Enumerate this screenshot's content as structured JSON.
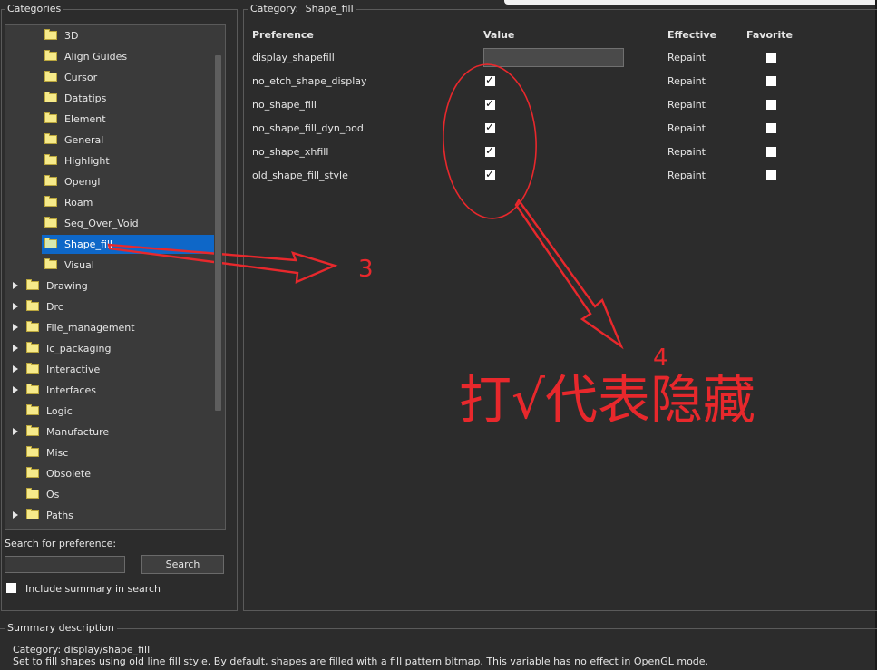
{
  "left_panel": {
    "title": "Categories",
    "tree": [
      {
        "label": "3D",
        "indent": 1,
        "expandable": false,
        "selected": false
      },
      {
        "label": "Align Guides",
        "indent": 1,
        "expandable": false,
        "selected": false
      },
      {
        "label": "Cursor",
        "indent": 1,
        "expandable": false,
        "selected": false
      },
      {
        "label": "Datatips",
        "indent": 1,
        "expandable": false,
        "selected": false
      },
      {
        "label": "Element",
        "indent": 1,
        "expandable": false,
        "selected": false
      },
      {
        "label": "General",
        "indent": 1,
        "expandable": false,
        "selected": false
      },
      {
        "label": "Highlight",
        "indent": 1,
        "expandable": false,
        "selected": false
      },
      {
        "label": "Opengl",
        "indent": 1,
        "expandable": false,
        "selected": false
      },
      {
        "label": "Roam",
        "indent": 1,
        "expandable": false,
        "selected": false
      },
      {
        "label": "Seg_Over_Void",
        "indent": 1,
        "expandable": false,
        "selected": false
      },
      {
        "label": "Shape_fill",
        "indent": 1,
        "expandable": false,
        "selected": true
      },
      {
        "label": "Visual",
        "indent": 1,
        "expandable": false,
        "selected": false
      },
      {
        "label": "Drawing",
        "indent": 0,
        "expandable": true,
        "selected": false
      },
      {
        "label": "Drc",
        "indent": 0,
        "expandable": true,
        "selected": false
      },
      {
        "label": "File_management",
        "indent": 0,
        "expandable": true,
        "selected": false
      },
      {
        "label": "Ic_packaging",
        "indent": 0,
        "expandable": true,
        "selected": false
      },
      {
        "label": "Interactive",
        "indent": 0,
        "expandable": true,
        "selected": false
      },
      {
        "label": "Interfaces",
        "indent": 0,
        "expandable": true,
        "selected": false
      },
      {
        "label": "Logic",
        "indent": 0,
        "expandable": false,
        "selected": false
      },
      {
        "label": "Manufacture",
        "indent": 0,
        "expandable": true,
        "selected": false
      },
      {
        "label": "Misc",
        "indent": 0,
        "expandable": false,
        "selected": false
      },
      {
        "label": "Obsolete",
        "indent": 0,
        "expandable": false,
        "selected": false
      },
      {
        "label": "Os",
        "indent": 0,
        "expandable": false,
        "selected": false
      },
      {
        "label": "Paths",
        "indent": 0,
        "expandable": true,
        "selected": false
      }
    ],
    "search_label": "Search for preference:",
    "search_value": "",
    "search_button": "Search",
    "include_summary_label": "Include summary in search",
    "include_summary_checked": false
  },
  "right_panel": {
    "category_label": "Category:",
    "category_value": "Shape_fill",
    "columns": {
      "preference": "Preference",
      "value": "Value",
      "effective": "Effective",
      "favorite": "Favorite"
    },
    "rows": [
      {
        "preference": "display_shapefill",
        "value_type": "text",
        "value": "",
        "effective": "Repaint",
        "favorite": false
      },
      {
        "preference": "no_etch_shape_display",
        "value_type": "checkbox",
        "checked": true,
        "effective": "Repaint",
        "favorite": false
      },
      {
        "preference": "no_shape_fill",
        "value_type": "checkbox",
        "checked": true,
        "effective": "Repaint",
        "favorite": false
      },
      {
        "preference": "no_shape_fill_dyn_ood",
        "value_type": "checkbox",
        "checked": true,
        "effective": "Repaint",
        "favorite": false
      },
      {
        "preference": "no_shape_xhfill",
        "value_type": "checkbox",
        "checked": true,
        "effective": "Repaint",
        "favorite": false
      },
      {
        "preference": "old_shape_fill_style",
        "value_type": "checkbox",
        "checked": true,
        "effective": "Repaint",
        "favorite": false
      }
    ]
  },
  "summary": {
    "title": "Summary description",
    "category_line": "Category: display/shape_fill",
    "description": "Set to fill shapes using old line fill style. By default, shapes are filled with a fill pattern bitmap. This variable has no effect in OpenGL mode."
  },
  "annotations": {
    "color": "#e8282c",
    "label_3": "3",
    "label_4": "4",
    "note": "打√代表隐藏"
  }
}
